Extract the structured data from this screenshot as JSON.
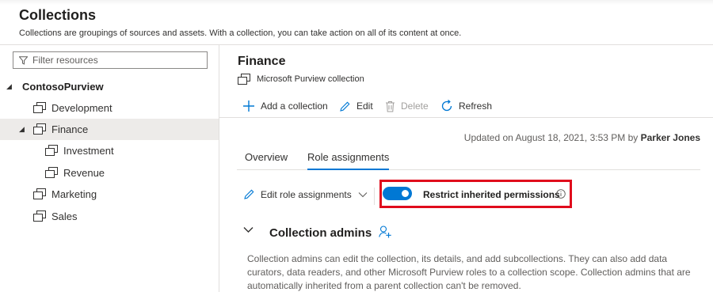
{
  "header": {
    "title": "Collections",
    "subtitle": "Collections are groupings of sources and assets. With a collection, you can take action on all of its content at once."
  },
  "sidebar": {
    "filter_placeholder": "Filter resources",
    "items": [
      {
        "label": "ContosoPurview",
        "icon": "caret-down"
      },
      {
        "label": "Development",
        "icon": "collection-icon"
      },
      {
        "label": "Finance",
        "icon": "collection-icon",
        "selected": true
      },
      {
        "label": "Investment",
        "icon": "collection-icon"
      },
      {
        "label": "Revenue",
        "icon": "collection-icon"
      },
      {
        "label": "Marketing",
        "icon": "collection-icon"
      },
      {
        "label": "Sales",
        "icon": "collection-icon"
      }
    ]
  },
  "main": {
    "collection_name": "Finance",
    "collection_type": "Microsoft Purview collection",
    "commands": {
      "add": "Add a collection",
      "edit": "Edit",
      "delete": "Delete",
      "refresh": "Refresh"
    },
    "updated_prefix": "Updated on August 18, 2021, 3:53 PM by ",
    "updated_by": "Parker Jones",
    "tabs": [
      {
        "label": "Overview",
        "active": false
      },
      {
        "label": "Role assignments",
        "active": true
      }
    ],
    "edit_roles_label": "Edit role assignments",
    "restrict_label": "Restrict inherited permissions",
    "restrict_enabled": true,
    "section_title": "Collection admins",
    "section_description": "Collection admins can edit the collection, its details, and add subcollections. They can also add data curators, data readers, and other Microsoft Purview roles to a collection scope. Collection admins that are automatically inherited from a parent collection can't be removed."
  },
  "colors": {
    "accent": "#0078d4",
    "highlight_border": "#e00b1c",
    "selected_row": "#edebe9"
  }
}
